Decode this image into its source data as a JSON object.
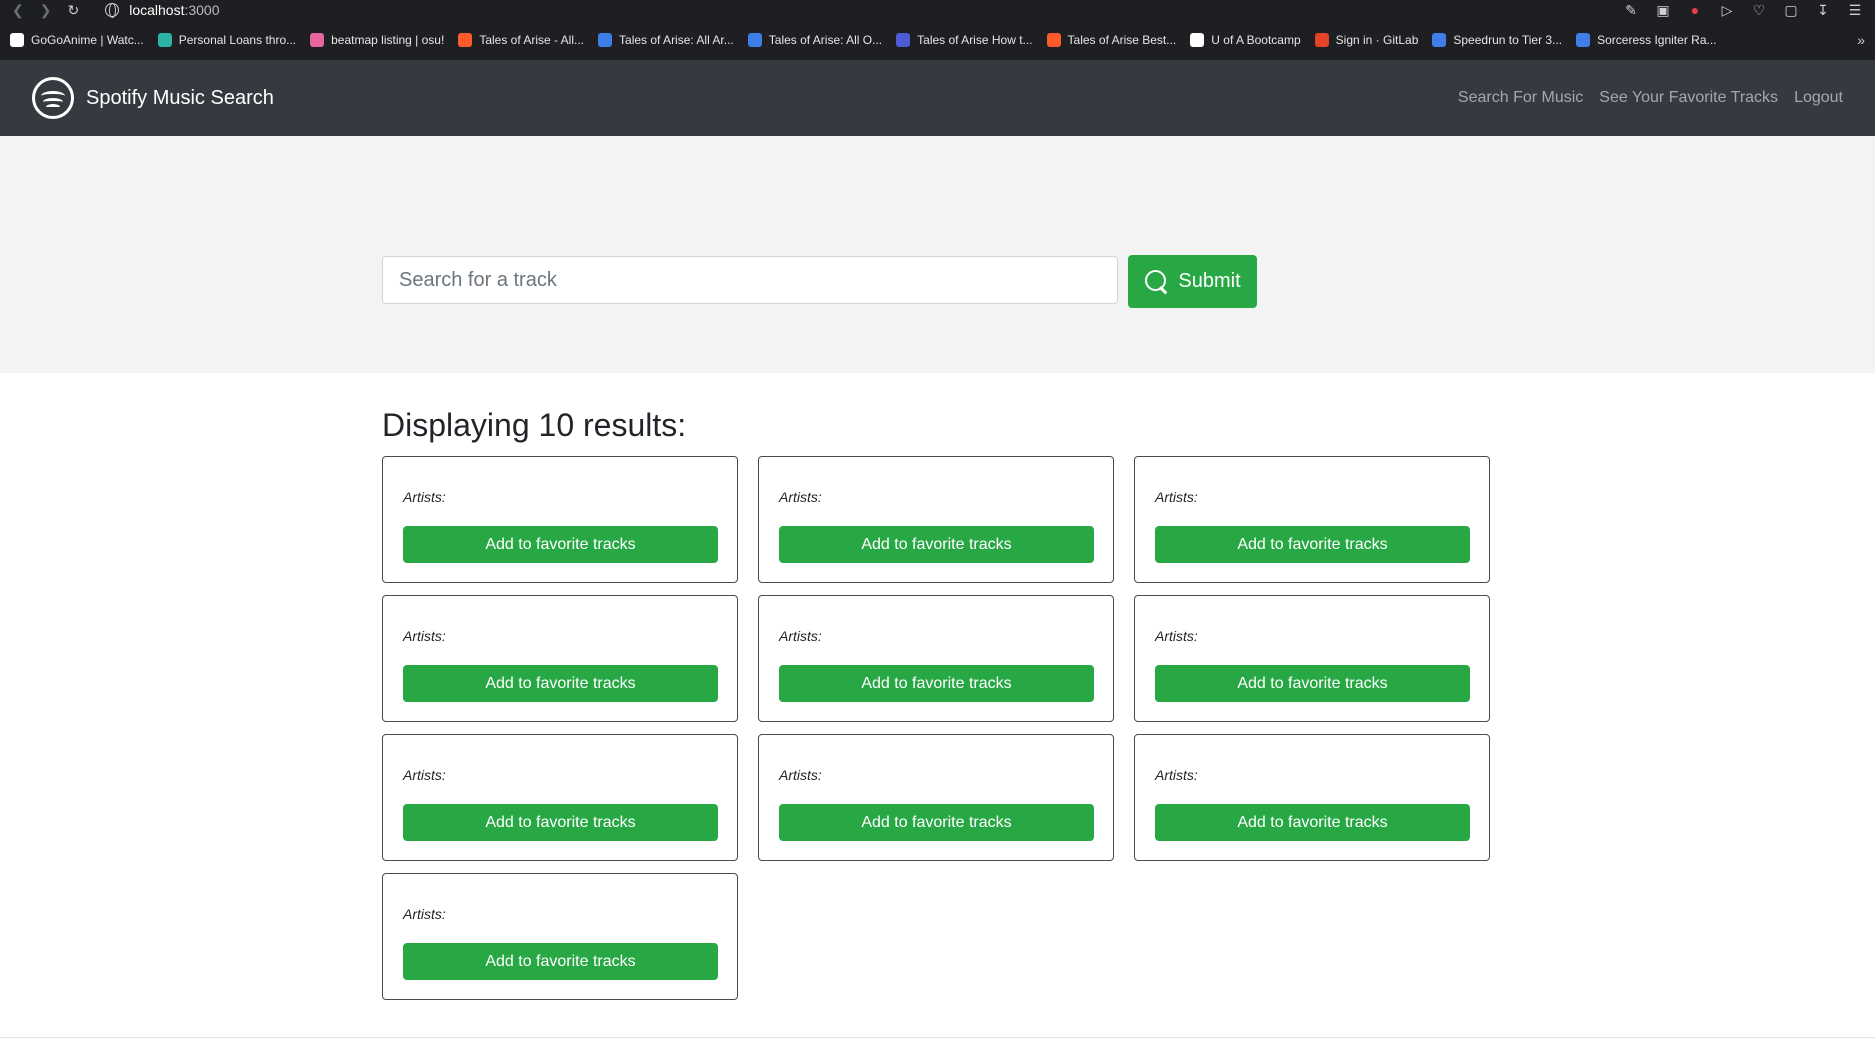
{
  "browser": {
    "url_host": "localhost",
    "url_port": ":3000",
    "bookmarks": [
      {
        "label": "GoGoAnime | Watc...",
        "color": "#ffffff"
      },
      {
        "label": "Personal Loans thro...",
        "color": "#2bb3a3"
      },
      {
        "label": "beatmap listing | osu!",
        "color": "#e5679e"
      },
      {
        "label": "Tales of Arise - All...",
        "color": "#ff5a2a"
      },
      {
        "label": "Tales of Arise: All Ar...",
        "color": "#3d7ee8"
      },
      {
        "label": "Tales of Arise: All O...",
        "color": "#3d7ee8"
      },
      {
        "label": "Tales of Arise How t...",
        "color": "#4f5bd5"
      },
      {
        "label": "Tales of Arise Best...",
        "color": "#ff5a2a"
      },
      {
        "label": "U of A Bootcamp",
        "color": "#ffffff"
      },
      {
        "label": "Sign in · GitLab",
        "color": "#e24329"
      },
      {
        "label": "Speedrun to Tier 3...",
        "color": "#3d7ee8"
      },
      {
        "label": "Sorceress Igniter Ra...",
        "color": "#3d7ee8"
      }
    ]
  },
  "navbar": {
    "brand": "Spotify Music Search",
    "links": [
      "Search For Music",
      "See Your Favorite Tracks",
      "Logout"
    ]
  },
  "search": {
    "placeholder": "Search for a track",
    "value": "",
    "submit_label": "Submit"
  },
  "results": {
    "heading": "Displaying 10 results:",
    "cards": [
      {
        "artists_label": "Artists:",
        "button_label": "Add to favorite tracks"
      },
      {
        "artists_label": "Artists:",
        "button_label": "Add to favorite tracks"
      },
      {
        "artists_label": "Artists:",
        "button_label": "Add to favorite tracks"
      },
      {
        "artists_label": "Artists:",
        "button_label": "Add to favorite tracks"
      },
      {
        "artists_label": "Artists:",
        "button_label": "Add to favorite tracks"
      },
      {
        "artists_label": "Artists:",
        "button_label": "Add to favorite tracks"
      },
      {
        "artists_label": "Artists:",
        "button_label": "Add to favorite tracks"
      },
      {
        "artists_label": "Artists:",
        "button_label": "Add to favorite tracks"
      },
      {
        "artists_label": "Artists:",
        "button_label": "Add to favorite tracks"
      },
      {
        "artists_label": "Artists:",
        "button_label": "Add to favorite tracks"
      }
    ]
  },
  "colors": {
    "navbar_bg": "#343a40",
    "success": "#28a745",
    "hero_bg": "#f3f3f4"
  }
}
